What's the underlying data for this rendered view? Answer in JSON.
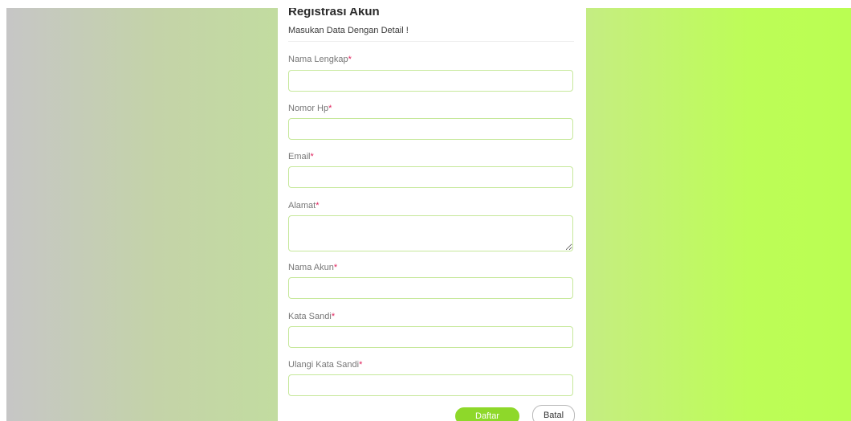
{
  "form": {
    "title": "Registrasi Akun",
    "subtitle": "Masukan Data Dengan Detail !",
    "required_mark": "*",
    "fields": [
      {
        "label": "Nama Lengkap",
        "value": "",
        "placeholder": ""
      },
      {
        "label": "Nomor Hp",
        "value": "",
        "placeholder": ""
      },
      {
        "label": "Email",
        "value": "",
        "placeholder": ""
      },
      {
        "label": "Alamat",
        "value": "",
        "placeholder": ""
      },
      {
        "label": "Nama Akun",
        "value": "",
        "placeholder": ""
      },
      {
        "label": "Kata Sandi",
        "value": "",
        "placeholder": ""
      },
      {
        "label": "Ulangi Kata Sandi",
        "value": "",
        "placeholder": ""
      }
    ],
    "buttons": {
      "submit_label": "Daftar",
      "cancel_label": "Batal"
    }
  },
  "colors": {
    "accent": "#8ed82a",
    "input_border": "#c6e89a",
    "required": "#e0245e",
    "background_left": "#c6c6c6",
    "background_right": "#bafe52"
  }
}
